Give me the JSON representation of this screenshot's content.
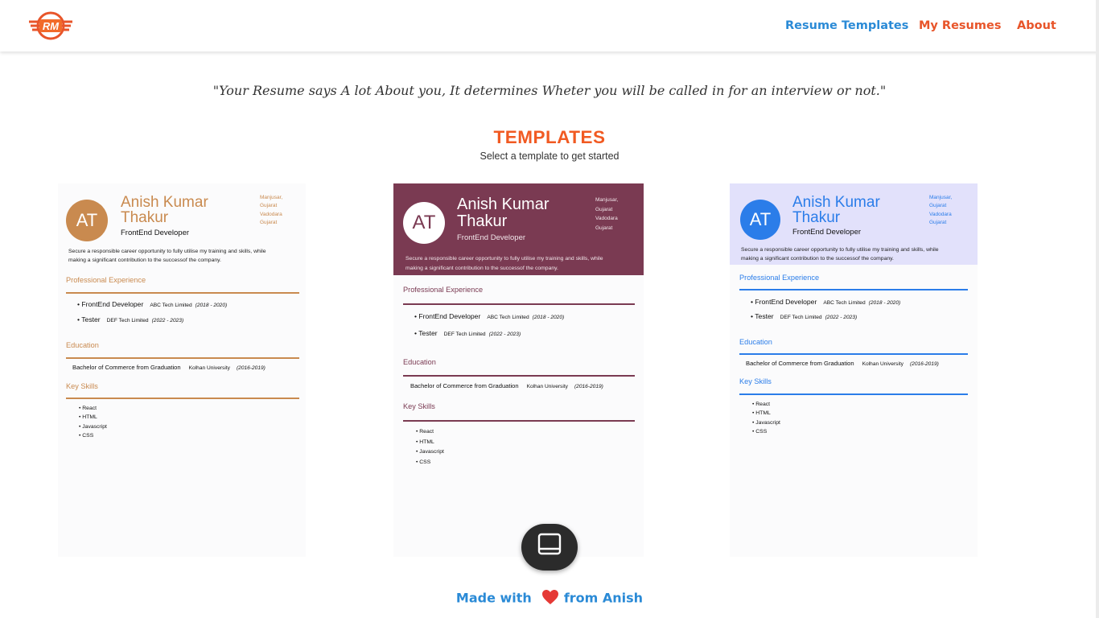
{
  "header": {
    "logo_text": "RM",
    "nav": [
      {
        "label": "Resume Templates"
      },
      {
        "label": "My Resumes"
      },
      {
        "label": "About"
      }
    ]
  },
  "quote": "\"Your Resume says A lot About you, It determines Wheter you will be called in for an interview or not.\"",
  "section": {
    "title": "TEMPLATES",
    "subtitle": "Select a template to get started"
  },
  "resume": {
    "initials": "AT",
    "name_line1": "Anish Kumar",
    "name_line2": "Thakur",
    "role": "FrontEnd  Developer",
    "address": [
      "Manjusar,",
      "Gujarat",
      "Vadodara",
      "Gujarat"
    ],
    "summary_line1": "Secure a responsible  career opportunity  to fully  utilise  my training  and skills, while",
    "summary_line2": "making  a significant  contribution  to the successof the company.",
    "experience_title": "Professional  Experience",
    "experience": [
      {
        "role": "FrontEnd  Developer",
        "company": "ABC Tech Limited",
        "dates": "(2018 - 2020)"
      },
      {
        "role": "Tester",
        "company": "DEF Tech Limited",
        "dates": "(2022 - 2023)"
      }
    ],
    "education_title": "Education",
    "education": {
      "degree": "Bachelor  of  Commerce  from  Graduation",
      "university": "Kolhan University",
      "dates": "(2016-2019)"
    },
    "skills_title": "Key Skills",
    "skills": [
      "• React",
      "• HTML",
      "• Javascript",
      "• CSS"
    ]
  },
  "templates": [
    {
      "accent": "#c98a4f",
      "header_bg": "#fbfbfc"
    },
    {
      "accent": "#7a3a52",
      "header_bg": "#7a3a52"
    },
    {
      "accent": "#2b7de9",
      "header_bg": "#e2e1fb"
    }
  ],
  "fab_icon": "laptop-icon",
  "footer": {
    "made_with": "Made with",
    "from": "from Anish"
  }
}
